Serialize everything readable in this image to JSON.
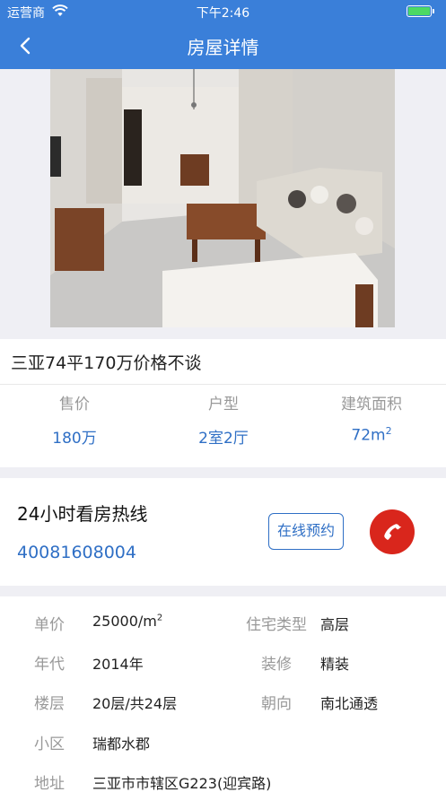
{
  "status_bar": {
    "carrier": "运营商",
    "time": "下午2:46",
    "battery_color": "#4cd964"
  },
  "nav": {
    "title": "房屋详情",
    "back_icon": "chevron-left-icon",
    "background": "#3a7fd9"
  },
  "listing": {
    "title": "三亚74平170万价格不谈",
    "stats": [
      {
        "label": "售价",
        "value": "180万"
      },
      {
        "label": "户型",
        "value": "2室2厅"
      },
      {
        "label": "建筑面积",
        "value": "72m",
        "unit_sup": "2"
      }
    ]
  },
  "hotline": {
    "title": "24小时看房热线",
    "number": "40081608004",
    "book_label": "在线预约",
    "call_icon": "phone-icon",
    "call_color": "#d9261c"
  },
  "details": {
    "unit_price_label": "单价",
    "unit_price_value": "25000/m",
    "unit_price_sup": "2",
    "house_type_label": "住宅类型",
    "house_type_value": "高层",
    "year_label": "年代",
    "year_value": "2014年",
    "decoration_label": "装修",
    "decoration_value": "精装",
    "floor_label": "楼层",
    "floor_value": "20层/共24层",
    "orientation_label": "朝向",
    "orientation_value": "南北通透",
    "community_label": "小区",
    "community_value": "瑞都水郡",
    "address_label": "地址",
    "address_value": "三亚市市辖区G223(迎宾路)"
  },
  "accent_color": "#2f6fc5"
}
